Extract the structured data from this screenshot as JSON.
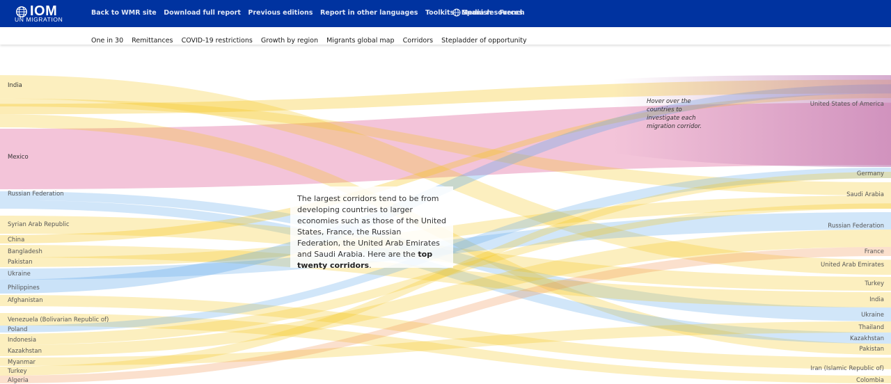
{
  "header": {
    "logo": {
      "word": "IOM",
      "sub": "UN MIGRATION"
    },
    "nav": [
      "Back to WMR site",
      "Download full report",
      "Previous editions",
      "Report in other languages",
      "Toolkits",
      "Media resources"
    ],
    "languages": [
      "Spanish",
      "French"
    ]
  },
  "subnav": [
    "One in 30",
    "Remittances",
    "COVID-19 restrictions",
    "Growth by region",
    "Migrants global map",
    "Corridors",
    "Stepladder of opportunity"
  ],
  "hint": "Hover over the countries to investigate each migration corridor.",
  "info": {
    "text": "The largest corridors tend to be from developing countries to larger economies such as those of the United States, France, the Russian Federation, the United Arab Emirates and Saudi Arabia. Here are the ",
    "emph": "top twenty corridors",
    "tail": "."
  },
  "colors": {
    "header": "#0033a0",
    "yellow": "#f5c518",
    "pink": "#d9468a",
    "blue": "#5aa6e8",
    "orange": "#f0904a",
    "purple": "#b56aa8"
  },
  "chart_data": {
    "type": "sankey",
    "origins": [
      "India",
      "Mexico",
      "Russian Federation",
      "Syrian Arab Republic",
      "China",
      "Bangladesh",
      "Pakistan",
      "Ukraine",
      "Philippines",
      "Afghanistan",
      "Venezuela (Bolivarian Republic of)",
      "Poland",
      "Indonesia",
      "Kazakhstan",
      "Myanmar",
      "Turkey",
      "Algeria"
    ],
    "destinations": [
      "United States of America",
      "Germany",
      "Saudi Arabia",
      "Russian Federation",
      "France",
      "United Arab Emirates",
      "Turkey",
      "India",
      "Ukraine",
      "Thailand",
      "Kazakhstan",
      "Pakistan",
      "Iran (Islamic Republic of)",
      "Colombia"
    ]
  }
}
